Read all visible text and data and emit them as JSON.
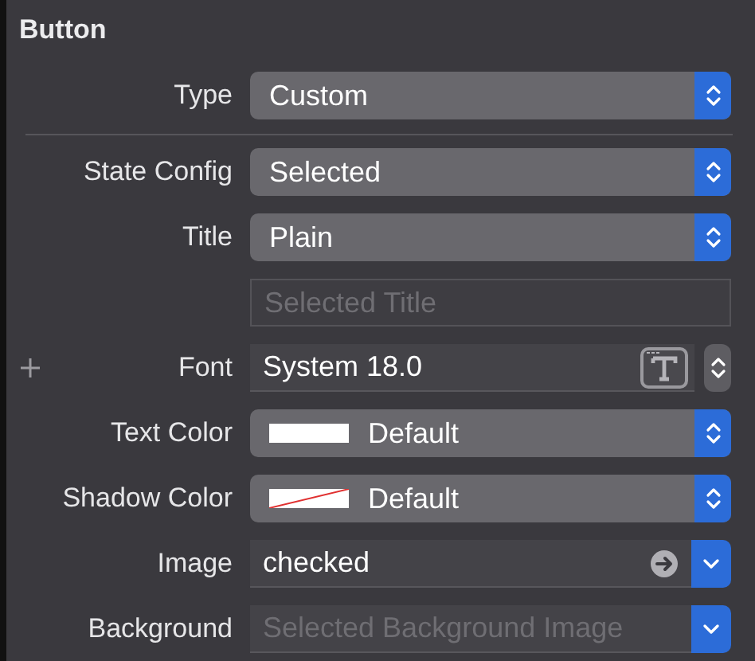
{
  "section": {
    "title": "Button"
  },
  "groups": [
    {
      "rows": [
        {
          "kind": "popup",
          "label": "Type",
          "value": "Custom"
        }
      ]
    },
    {
      "rows": [
        {
          "kind": "popup",
          "label": "State Config",
          "value": "Selected"
        },
        {
          "kind": "popup",
          "label": "Title",
          "value": "Plain"
        },
        {
          "kind": "textfield",
          "placeholder": "Selected Title"
        },
        {
          "kind": "font",
          "label": "Font",
          "value": "System 18.0"
        },
        {
          "kind": "colorpopup",
          "label": "Text Color",
          "value": "Default",
          "color": "#ffffff",
          "clear": false
        },
        {
          "kind": "colorpopup",
          "label": "Shadow Color",
          "value": "Default",
          "color": "#ffffff",
          "clear": true
        },
        {
          "kind": "combo",
          "label": "Image",
          "value": "checked"
        },
        {
          "kind": "combo",
          "label": "Background",
          "placeholder": "Selected Background Image"
        }
      ]
    }
  ]
}
